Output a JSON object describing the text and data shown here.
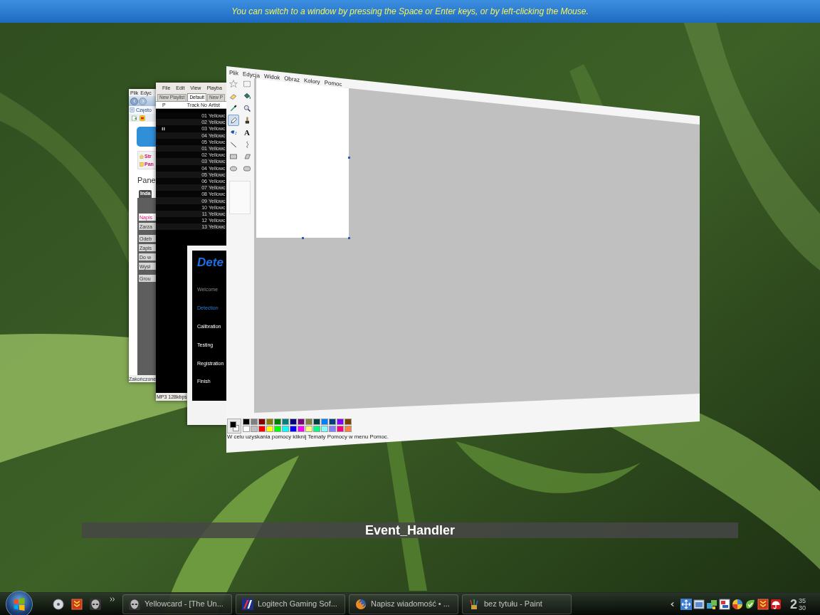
{
  "hint_bar": {
    "text": "You can switch to a window by pressing the Space or Enter keys, or by left-clicking the Mouse."
  },
  "browser_window": {
    "menu": [
      "Plik",
      "Edyc"
    ],
    "favorites_item": "Często",
    "links": [
      "Str",
      "Pan"
    ],
    "heading": "Pane",
    "tab": "Inda",
    "button_groups": [
      [
        {
          "label": "Napis",
          "selected": true
        },
        {
          "label": "Zarza",
          "selected": false
        }
      ],
      [
        {
          "label": "Odeb",
          "selected": false
        },
        {
          "label": "Zapis",
          "selected": false
        },
        {
          "label": "Do w",
          "selected": false
        },
        {
          "label": "Wysł",
          "selected": false
        }
      ],
      [
        {
          "label": "Grou",
          "selected": false
        }
      ]
    ],
    "status": "Zakończone"
  },
  "player_window": {
    "menu": [
      "File",
      "Edit",
      "View",
      "Playba"
    ],
    "tabs": [
      {
        "label": "New Playlist",
        "selected": false
      },
      {
        "label": "Default",
        "selected": true
      },
      {
        "label": "New P",
        "selected": false
      }
    ],
    "columns": [
      "P",
      "Track No",
      "Artist"
    ],
    "rows": [
      {
        "track": "01",
        "artist": "Yellowc",
        "paused": false
      },
      {
        "track": "02",
        "artist": "Yellowc",
        "paused": false
      },
      {
        "track": "03",
        "artist": "Yellowc",
        "paused": true
      },
      {
        "track": "04",
        "artist": "Yellowc",
        "paused": false
      },
      {
        "track": "05",
        "artist": "Yellowc",
        "paused": false
      },
      {
        "track": "01",
        "artist": "Yellowc",
        "paused": false
      },
      {
        "track": "02",
        "artist": "Yellowc",
        "paused": false
      },
      {
        "track": "03",
        "artist": "Yellowc",
        "paused": false
      },
      {
        "track": "04",
        "artist": "Yellowc",
        "paused": false
      },
      {
        "track": "05",
        "artist": "Yellowc",
        "paused": false
      },
      {
        "track": "06",
        "artist": "Yellowc",
        "paused": false
      },
      {
        "track": "07",
        "artist": "Yellowc",
        "paused": false
      },
      {
        "track": "08",
        "artist": "Yellowc",
        "paused": false
      },
      {
        "track": "09",
        "artist": "Yellowc",
        "paused": false
      },
      {
        "track": "10",
        "artist": "Yellowc",
        "paused": false
      },
      {
        "track": "11",
        "artist": "Yellowc",
        "paused": false
      },
      {
        "track": "12",
        "artist": "Yellowc",
        "paused": false
      },
      {
        "track": "13",
        "artist": "Yellowc",
        "paused": false
      }
    ],
    "status": "MP3 128kbps"
  },
  "setup_window": {
    "title": "Dete",
    "steps": [
      {
        "label": "Welcome",
        "completed": true,
        "selected": false
      },
      {
        "label": "Detection",
        "completed": false,
        "selected": true
      },
      {
        "label": "Calibration",
        "completed": false,
        "selected": false
      },
      {
        "label": "Testing",
        "completed": false,
        "selected": false
      },
      {
        "label": "Registration",
        "completed": false,
        "selected": false
      },
      {
        "label": "Finish",
        "completed": false,
        "selected": false
      }
    ]
  },
  "paint_window": {
    "menu": [
      "Plik",
      "Edycja",
      "Widok",
      "Obraz",
      "Kolory",
      "Pomoc"
    ],
    "tools": [
      {
        "selected": false
      },
      {
        "selected": false
      },
      {
        "selected": false
      },
      {
        "selected": false
      },
      {
        "selected": false
      },
      {
        "selected": false
      },
      {
        "selected": true
      },
      {
        "selected": false
      },
      {
        "selected": false
      },
      {
        "selected": false,
        "label": "A"
      },
      {
        "selected": false
      },
      {
        "selected": false
      },
      {
        "selected": false
      },
      {
        "selected": false
      },
      {
        "selected": false
      },
      {
        "selected": false
      }
    ],
    "current_colors": [
      {
        "color": "#000000"
      },
      {
        "color": "#ffffff"
      }
    ],
    "palette": [
      {
        "color": "#000000"
      },
      {
        "color": "#808080"
      },
      {
        "color": "#800000"
      },
      {
        "color": "#808000"
      },
      {
        "color": "#008000"
      },
      {
        "color": "#008080"
      },
      {
        "color": "#000080"
      },
      {
        "color": "#800080"
      },
      {
        "color": "#808040"
      },
      {
        "color": "#004040"
      },
      {
        "color": "#0080ff"
      },
      {
        "color": "#004080"
      },
      {
        "color": "#8000ff"
      },
      {
        "color": "#804000"
      },
      {
        "color": "#ffffff"
      },
      {
        "color": "#c0c0c0"
      },
      {
        "color": "#ff0000"
      },
      {
        "color": "#ffff00"
      },
      {
        "color": "#00ff00"
      },
      {
        "color": "#00ffff"
      },
      {
        "color": "#0000ff"
      },
      {
        "color": "#ff00ff"
      },
      {
        "color": "#ffff80"
      },
      {
        "color": "#00ff80"
      },
      {
        "color": "#80ffff"
      },
      {
        "color": "#8080ff"
      },
      {
        "color": "#ff0080"
      },
      {
        "color": "#ff8040"
      }
    ],
    "status": "W celu uzyskania pomocy kliknij Tematy Pomocy w menu Pomoc."
  },
  "caption": "Event_Handler",
  "taskbar": {
    "tasks": [
      {
        "label": "Yellowcard - [The Un..."
      },
      {
        "label": "Logitech Gaming Sof..."
      },
      {
        "label": "Napisz wiadomość • ..."
      },
      {
        "label": "bez tytułu - Paint"
      }
    ],
    "clock": {
      "hour": "2",
      "minute": "35",
      "second": "30"
    }
  }
}
